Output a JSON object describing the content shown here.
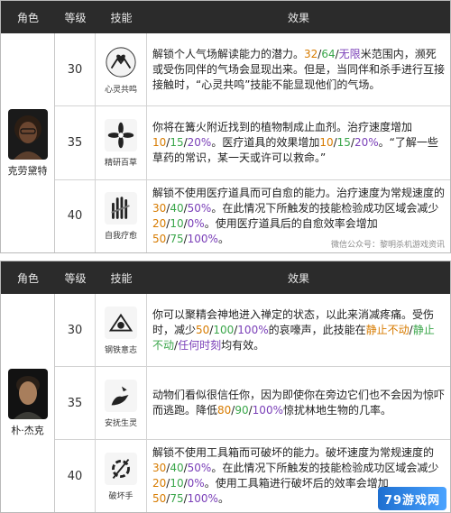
{
  "colors": {
    "orange": "#d77b00",
    "green": "#3aa64a",
    "purple": "#7a3fb8",
    "red": "#d93b3b"
  },
  "table1": {
    "headers": {
      "role": "角色",
      "level": "等级",
      "skill": "技能",
      "effect": "效果"
    },
    "character": {
      "name": "克劳黛特"
    },
    "rows": [
      {
        "level": "30",
        "skill_name": "心灵共鸣",
        "icon": "hands-heart-icon",
        "segments": [
          {
            "text": "解锁个人气场解读能力的潜力。"
          },
          {
            "text": "32",
            "color": "orange"
          },
          {
            "text": "/"
          },
          {
            "text": "64",
            "color": "green"
          },
          {
            "text": "/"
          },
          {
            "text": "无限",
            "color": "purple"
          },
          {
            "text": "米范围内，濒死或受伤同伴的气场会显现出来。但是，当同伴和杀手进行互接接触时，“心灵共鸣”技能不能显现他们的气场。"
          }
        ]
      },
      {
        "level": "35",
        "skill_name": "精研百草",
        "icon": "flower-icon",
        "segments": [
          {
            "text": "你将在篝火附近找到的植物制成止血剂。治疗速度增加"
          },
          {
            "text": "10",
            "color": "orange"
          },
          {
            "text": "/"
          },
          {
            "text": "15",
            "color": "green"
          },
          {
            "text": "/"
          },
          {
            "text": "20%",
            "color": "purple"
          },
          {
            "text": "。医疗道具的效果增加"
          },
          {
            "text": "10",
            "color": "orange"
          },
          {
            "text": "/"
          },
          {
            "text": "15",
            "color": "green"
          },
          {
            "text": "/"
          },
          {
            "text": "20%",
            "color": "purple"
          },
          {
            "text": "。“了解一些草药的常识，某一天或许可以救命。”"
          }
        ]
      },
      {
        "level": "40",
        "skill_name": "自我疗愈",
        "icon": "bandaged-hand-icon",
        "segments": [
          {
            "text": "解锁不使用医疗道具而可自愈的能力。治疗速度为常规速度的"
          },
          {
            "text": "30",
            "color": "orange"
          },
          {
            "text": "/"
          },
          {
            "text": "40",
            "color": "green"
          },
          {
            "text": "/"
          },
          {
            "text": "50%",
            "color": "purple"
          },
          {
            "text": "。在此情况下所触发的技能检验成功区域会减少"
          },
          {
            "text": "20",
            "color": "orange"
          },
          {
            "text": "/"
          },
          {
            "text": "10",
            "color": "green"
          },
          {
            "text": "/"
          },
          {
            "text": "0%",
            "color": "purple"
          },
          {
            "text": "。使用医疗道具后的自愈效率会增加"
          },
          {
            "text": "50",
            "color": "orange"
          },
          {
            "text": "/"
          },
          {
            "text": "75",
            "color": "green"
          },
          {
            "text": "/"
          },
          {
            "text": "100%",
            "color": "purple"
          },
          {
            "text": "。"
          }
        ]
      }
    ],
    "watermark": "微信公众号：黎明杀机游戏资讯"
  },
  "table2": {
    "headers": {
      "role": "角色",
      "level": "等级",
      "skill": "技能",
      "effect": "效果"
    },
    "character": {
      "name": "朴·杰克"
    },
    "rows": [
      {
        "level": "30",
        "skill_name": "钢铁意志",
        "icon": "clasped-hands-icon",
        "segments": [
          {
            "text": "你可以聚精会神地进入禅定的状态，以此来消减疼痛。受伤时，减少"
          },
          {
            "text": "50",
            "color": "orange"
          },
          {
            "text": "/"
          },
          {
            "text": "100",
            "color": "green"
          },
          {
            "text": "/"
          },
          {
            "text": "100%",
            "color": "purple"
          },
          {
            "text": "的哀嚎声，此技能在"
          },
          {
            "text": "静止不动",
            "color": "orange"
          },
          {
            "text": "/"
          },
          {
            "text": "静止不动",
            "color": "green"
          },
          {
            "text": "/"
          },
          {
            "text": "任何时刻",
            "color": "purple"
          },
          {
            "text": "均有效。"
          }
        ]
      },
      {
        "level": "35",
        "skill_name": "安抚生灵",
        "icon": "hand-crow-icon",
        "segments": [
          {
            "text": "动物们看似很信任你，因为即使你在旁边它们也不会因为惊吓而逃跑。降低"
          },
          {
            "text": "80",
            "color": "orange"
          },
          {
            "text": "/"
          },
          {
            "text": "90",
            "color": "green"
          },
          {
            "text": "/"
          },
          {
            "text": "100%",
            "color": "purple"
          },
          {
            "text": "惊扰林地生物的几率。"
          }
        ]
      },
      {
        "level": "40",
        "skill_name": "破坏手",
        "icon": "broken-gear-icon",
        "segments": [
          {
            "text": "解锁不使用工具箱而可破坏的能力。破坏速度为常规速度的"
          },
          {
            "text": "30",
            "color": "orange"
          },
          {
            "text": "/"
          },
          {
            "text": "40",
            "color": "green"
          },
          {
            "text": "/"
          },
          {
            "text": "50%",
            "color": "purple"
          },
          {
            "text": "。在此情况下所触发的技能检验成功区域会减少"
          },
          {
            "text": "20",
            "color": "orange"
          },
          {
            "text": "/"
          },
          {
            "text": "10",
            "color": "green"
          },
          {
            "text": "/"
          },
          {
            "text": "0%",
            "color": "purple"
          },
          {
            "text": "。使用工具箱进行破坏后的效率会增加"
          },
          {
            "text": "50",
            "color": "orange"
          },
          {
            "text": "/"
          },
          {
            "text": "75",
            "color": "green"
          },
          {
            "text": "/"
          },
          {
            "text": "100%",
            "color": "purple"
          },
          {
            "text": "。"
          }
        ]
      }
    ],
    "logo": "79游戏网"
  }
}
